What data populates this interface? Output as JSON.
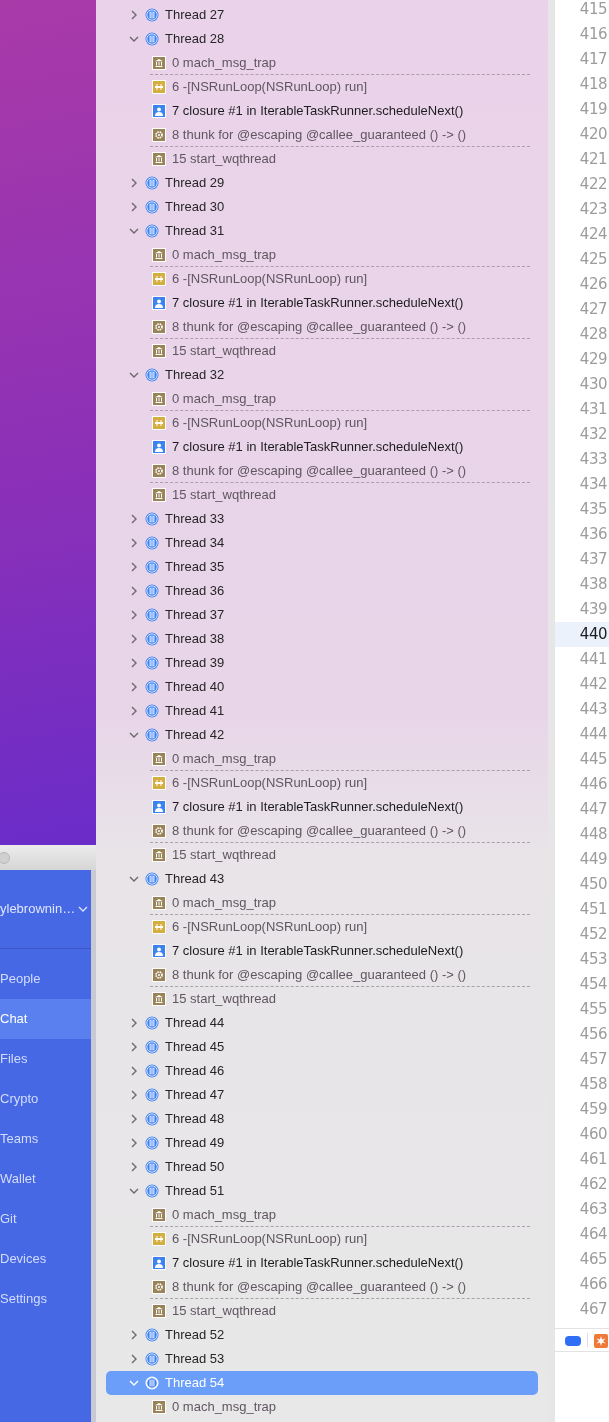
{
  "keybase": {
    "account": "ylebrownin…",
    "nav": [
      {
        "label": "People",
        "selected": false
      },
      {
        "label": "Chat",
        "selected": true
      },
      {
        "label": "Files",
        "selected": false
      },
      {
        "label": "Crypto",
        "selected": false
      },
      {
        "label": "Teams",
        "selected": false
      },
      {
        "label": "Wallet",
        "selected": false
      },
      {
        "label": "Git",
        "selected": false
      },
      {
        "label": "Devices",
        "selected": false
      },
      {
        "label": "Settings",
        "selected": false
      }
    ]
  },
  "debug_navigator": {
    "threads": [
      {
        "name": "Thread 27",
        "expanded": false,
        "selected": false
      },
      {
        "name": "Thread 28",
        "expanded": true,
        "selected": false,
        "frames": [
          {
            "label": "0 mach_msg_trap",
            "kind": "kernel",
            "elided_after": true
          },
          {
            "label": "6 -[NSRunLoop(NSRunLoop) run]",
            "kind": "foundation",
            "elided_after": false
          },
          {
            "label": "7 closure #1 in IterableTaskRunner.scheduleNext()",
            "kind": "user",
            "elided_after": false
          },
          {
            "label": "8 thunk for @escaping @callee_guaranteed () -> ()",
            "kind": "thunk",
            "elided_after": true
          },
          {
            "label": "15 start_wqthread",
            "kind": "kernel",
            "elided_after": false
          }
        ]
      },
      {
        "name": "Thread 29",
        "expanded": false,
        "selected": false
      },
      {
        "name": "Thread 30",
        "expanded": false,
        "selected": false
      },
      {
        "name": "Thread 31",
        "expanded": true,
        "selected": false,
        "frames": [
          {
            "label": "0 mach_msg_trap",
            "kind": "kernel",
            "elided_after": true
          },
          {
            "label": "6 -[NSRunLoop(NSRunLoop) run]",
            "kind": "foundation",
            "elided_after": false
          },
          {
            "label": "7 closure #1 in IterableTaskRunner.scheduleNext()",
            "kind": "user",
            "elided_after": false
          },
          {
            "label": "8 thunk for @escaping @callee_guaranteed () -> ()",
            "kind": "thunk",
            "elided_after": true
          },
          {
            "label": "15 start_wqthread",
            "kind": "kernel",
            "elided_after": false
          }
        ]
      },
      {
        "name": "Thread 32",
        "expanded": true,
        "selected": false,
        "frames": [
          {
            "label": "0 mach_msg_trap",
            "kind": "kernel",
            "elided_after": true
          },
          {
            "label": "6 -[NSRunLoop(NSRunLoop) run]",
            "kind": "foundation",
            "elided_after": false
          },
          {
            "label": "7 closure #1 in IterableTaskRunner.scheduleNext()",
            "kind": "user",
            "elided_after": false
          },
          {
            "label": "8 thunk for @escaping @callee_guaranteed () -> ()",
            "kind": "thunk",
            "elided_after": true
          },
          {
            "label": "15 start_wqthread",
            "kind": "kernel",
            "elided_after": false
          }
        ]
      },
      {
        "name": "Thread 33",
        "expanded": false,
        "selected": false
      },
      {
        "name": "Thread 34",
        "expanded": false,
        "selected": false
      },
      {
        "name": "Thread 35",
        "expanded": false,
        "selected": false
      },
      {
        "name": "Thread 36",
        "expanded": false,
        "selected": false
      },
      {
        "name": "Thread 37",
        "expanded": false,
        "selected": false
      },
      {
        "name": "Thread 38",
        "expanded": false,
        "selected": false
      },
      {
        "name": "Thread 39",
        "expanded": false,
        "selected": false
      },
      {
        "name": "Thread 40",
        "expanded": false,
        "selected": false
      },
      {
        "name": "Thread 41",
        "expanded": false,
        "selected": false
      },
      {
        "name": "Thread 42",
        "expanded": true,
        "selected": false,
        "frames": [
          {
            "label": "0 mach_msg_trap",
            "kind": "kernel",
            "elided_after": true
          },
          {
            "label": "6 -[NSRunLoop(NSRunLoop) run]",
            "kind": "foundation",
            "elided_after": false
          },
          {
            "label": "7 closure #1 in IterableTaskRunner.scheduleNext()",
            "kind": "user",
            "elided_after": false
          },
          {
            "label": "8 thunk for @escaping @callee_guaranteed () -> ()",
            "kind": "thunk",
            "elided_after": true
          },
          {
            "label": "15 start_wqthread",
            "kind": "kernel",
            "elided_after": false
          }
        ]
      },
      {
        "name": "Thread 43",
        "expanded": true,
        "selected": false,
        "frames": [
          {
            "label": "0 mach_msg_trap",
            "kind": "kernel",
            "elided_after": true
          },
          {
            "label": "6 -[NSRunLoop(NSRunLoop) run]",
            "kind": "foundation",
            "elided_after": false
          },
          {
            "label": "7 closure #1 in IterableTaskRunner.scheduleNext()",
            "kind": "user",
            "elided_after": false
          },
          {
            "label": "8 thunk for @escaping @callee_guaranteed () -> ()",
            "kind": "thunk",
            "elided_after": true
          },
          {
            "label": "15 start_wqthread",
            "kind": "kernel",
            "elided_after": false
          }
        ]
      },
      {
        "name": "Thread 44",
        "expanded": false,
        "selected": false
      },
      {
        "name": "Thread 45",
        "expanded": false,
        "selected": false
      },
      {
        "name": "Thread 46",
        "expanded": false,
        "selected": false
      },
      {
        "name": "Thread 47",
        "expanded": false,
        "selected": false
      },
      {
        "name": "Thread 48",
        "expanded": false,
        "selected": false
      },
      {
        "name": "Thread 49",
        "expanded": false,
        "selected": false
      },
      {
        "name": "Thread 50",
        "expanded": false,
        "selected": false
      },
      {
        "name": "Thread 51",
        "expanded": true,
        "selected": false,
        "frames": [
          {
            "label": "0 mach_msg_trap",
            "kind": "kernel",
            "elided_after": true
          },
          {
            "label": "6 -[NSRunLoop(NSRunLoop) run]",
            "kind": "foundation",
            "elided_after": false
          },
          {
            "label": "7 closure #1 in IterableTaskRunner.scheduleNext()",
            "kind": "user",
            "elided_after": false
          },
          {
            "label": "8 thunk for @escaping @callee_guaranteed () -> ()",
            "kind": "thunk",
            "elided_after": true
          },
          {
            "label": "15 start_wqthread",
            "kind": "kernel",
            "elided_after": false
          }
        ]
      },
      {
        "name": "Thread 52",
        "expanded": false,
        "selected": false
      },
      {
        "name": "Thread 53",
        "expanded": false,
        "selected": false
      },
      {
        "name": "Thread 54",
        "expanded": true,
        "selected": true,
        "frames": [
          {
            "label": "0 mach_msg_trap",
            "kind": "kernel",
            "elided_after": false
          }
        ]
      }
    ]
  },
  "editor": {
    "line_numbers": [
      {
        "number": "415",
        "current": false
      },
      {
        "number": "416",
        "current": false
      },
      {
        "number": "417",
        "current": false
      },
      {
        "number": "418",
        "current": false
      },
      {
        "number": "419",
        "current": false
      },
      {
        "number": "420",
        "current": false
      },
      {
        "number": "421",
        "current": false
      },
      {
        "number": "422",
        "current": false
      },
      {
        "number": "423",
        "current": false
      },
      {
        "number": "424",
        "current": false
      },
      {
        "number": "425",
        "current": false
      },
      {
        "number": "426",
        "current": false
      },
      {
        "number": "427",
        "current": false
      },
      {
        "number": "428",
        "current": false
      },
      {
        "number": "429",
        "current": false
      },
      {
        "number": "430",
        "current": false
      },
      {
        "number": "431",
        "current": false
      },
      {
        "number": "432",
        "current": false
      },
      {
        "number": "433",
        "current": false
      },
      {
        "number": "434",
        "current": false
      },
      {
        "number": "435",
        "current": false
      },
      {
        "number": "436",
        "current": false
      },
      {
        "number": "437",
        "current": false
      },
      {
        "number": "438",
        "current": false
      },
      {
        "number": "439",
        "current": false
      },
      {
        "number": "440",
        "current": true
      },
      {
        "number": "441",
        "current": false
      },
      {
        "number": "442",
        "current": false
      },
      {
        "number": "443",
        "current": false
      },
      {
        "number": "444",
        "current": false
      },
      {
        "number": "445",
        "current": false
      },
      {
        "number": "446",
        "current": false
      },
      {
        "number": "447",
        "current": false
      },
      {
        "number": "448",
        "current": false
      },
      {
        "number": "449",
        "current": false
      },
      {
        "number": "450",
        "current": false
      },
      {
        "number": "451",
        "current": false
      },
      {
        "number": "452",
        "current": false
      },
      {
        "number": "453",
        "current": false
      },
      {
        "number": "454",
        "current": false
      },
      {
        "number": "455",
        "current": false
      },
      {
        "number": "456",
        "current": false
      },
      {
        "number": "457",
        "current": false
      },
      {
        "number": "458",
        "current": false
      },
      {
        "number": "459",
        "current": false
      },
      {
        "number": "460",
        "current": false
      },
      {
        "number": "461",
        "current": false
      },
      {
        "number": "462",
        "current": false
      },
      {
        "number": "463",
        "current": false
      },
      {
        "number": "464",
        "current": false
      },
      {
        "number": "465",
        "current": false
      },
      {
        "number": "466",
        "current": false
      },
      {
        "number": "467",
        "current": false
      }
    ]
  }
}
